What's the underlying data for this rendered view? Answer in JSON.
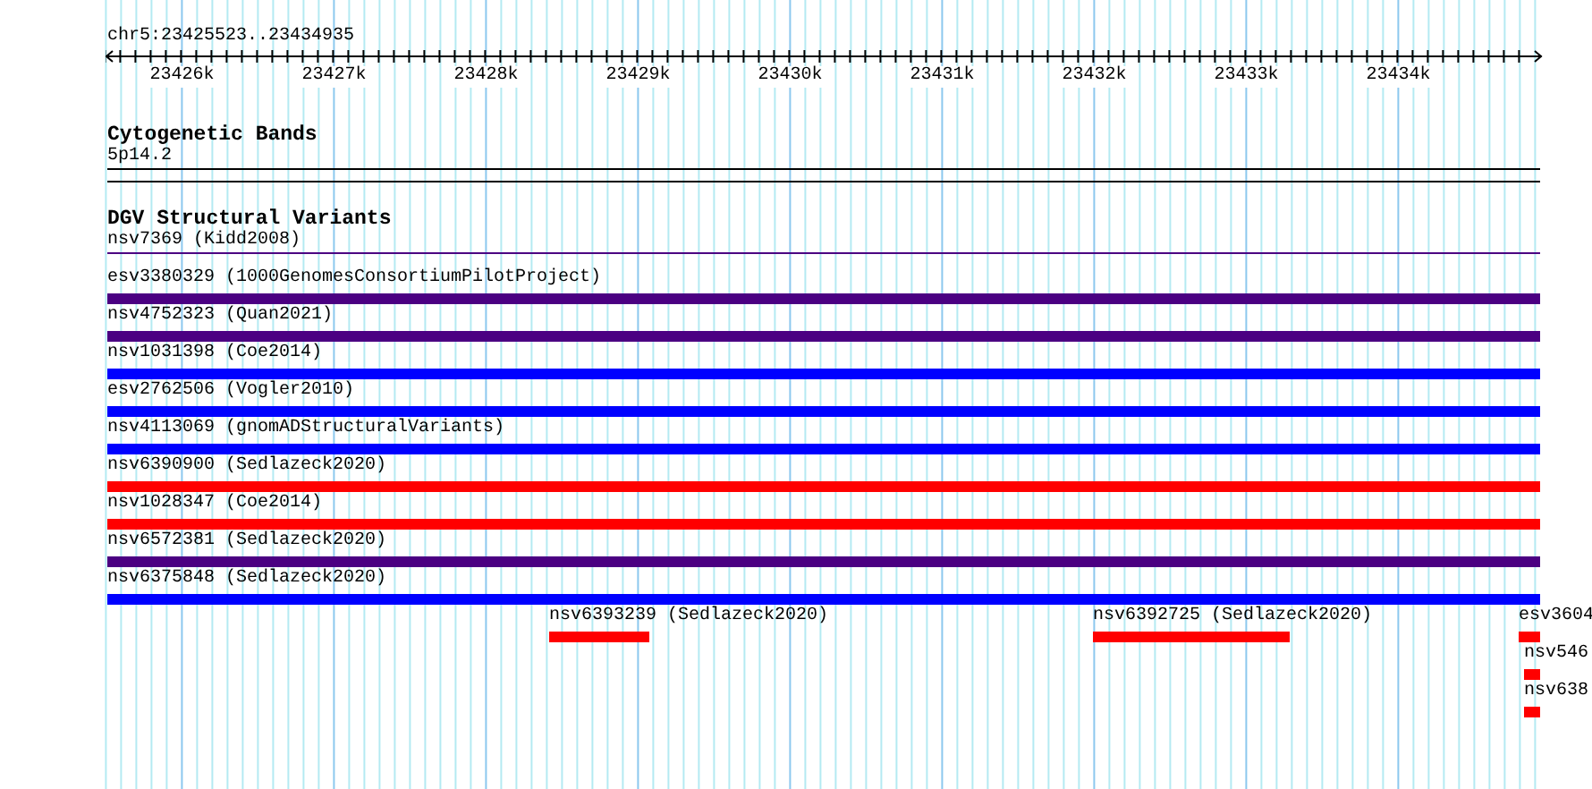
{
  "location": "chr5:23425523..23434935",
  "ruler": {
    "ticks": [
      "23426k",
      "23427k",
      "23428k",
      "23429k",
      "23430k",
      "23431k",
      "23432k",
      "23433k",
      "23434k"
    ]
  },
  "tracks": [
    {
      "title": "Cytogenetic Bands",
      "kind": "bands",
      "band": "5p14.2"
    },
    {
      "title": "DGV Structural Variants",
      "kind": "features",
      "features": [
        {
          "label": "nsv7369 (Kidd2008)",
          "kind": "line",
          "color": "#4b0082"
        },
        {
          "label": "esv3380329 (1000GenomesConsortiumPilotProject)",
          "kind": "full",
          "color": "#4b0082"
        },
        {
          "label": "nsv4752323 (Quan2021)",
          "kind": "full",
          "color": "#4b0082"
        },
        {
          "label": "nsv1031398 (Coe2014)",
          "kind": "full",
          "color": "#0000ff"
        },
        {
          "label": "esv2762506 (Vogler2010)",
          "kind": "full",
          "color": "#0000ff"
        },
        {
          "label": "nsv4113069 (gnomADStructuralVariants)",
          "kind": "full",
          "color": "#0000ff"
        },
        {
          "label": "nsv6390900 (Sedlazeck2020)",
          "kind": "full",
          "color": "#ff0000"
        },
        {
          "label": "nsv1028347 (Coe2014)",
          "kind": "full",
          "color": "#ff0000"
        },
        {
          "label": "nsv6572381 (Sedlazeck2020)",
          "kind": "full",
          "color": "#4b0082"
        },
        {
          "label": "nsv6375848 (Sedlazeck2020)",
          "kind": "full",
          "color": "#0000ff"
        },
        {
          "label": "nsv6393239 (Sedlazeck2020)",
          "kind": "partial",
          "color": "#ff0000"
        },
        {
          "label": "nsv6392725 (Sedlazeck2020)",
          "kind": "partial",
          "color": "#ff0000"
        },
        {
          "label": "esv3604",
          "kind": "partial",
          "color": "#ff0000"
        },
        {
          "label": "nsv546",
          "kind": "partial",
          "color": "#ff0000"
        },
        {
          "label": "nsv638",
          "kind": "partial",
          "color": "#ff0000"
        }
      ]
    }
  ]
}
